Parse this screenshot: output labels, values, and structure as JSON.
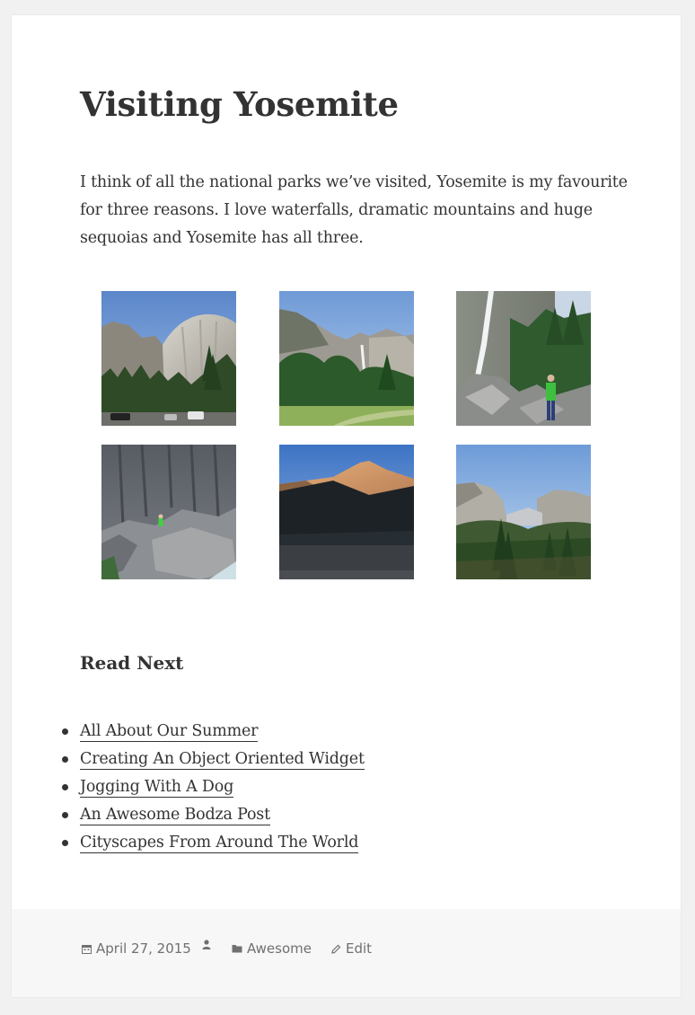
{
  "post": {
    "title": "Visiting Yosemite",
    "intro": "I think of all the national parks we’ve visited, Yosemite is my favourite for three reasons. I love waterfalls, dramatic mountains and huge sequoias and Yosemite has all three."
  },
  "gallery": {
    "images": [
      {
        "subject": "granite-cliff-photo"
      },
      {
        "subject": "valley-waterfall-photo"
      },
      {
        "subject": "waterfall-hiker-photo"
      },
      {
        "subject": "rock-wall-climber-photo"
      },
      {
        "subject": "sunset-peak-photo"
      },
      {
        "subject": "tunnel-view-photo"
      }
    ]
  },
  "read_next": {
    "title": "Read Next",
    "items": [
      {
        "label": "All About Our Summer"
      },
      {
        "label": "Creating An Object Oriented Widget"
      },
      {
        "label": "Jogging With A Dog"
      },
      {
        "label": "An Awesome Bodza Post"
      },
      {
        "label": "Cityscapes From Around The World"
      }
    ]
  },
  "footer": {
    "date": "April 27, 2015",
    "category": "Awesome",
    "edit_label": "Edit",
    "icons": {
      "date": "calendar-icon",
      "author": "person-icon",
      "category": "folder-icon",
      "edit": "pencil-icon"
    }
  },
  "colors": {
    "background": "#f1f1f1",
    "card": "#ffffff",
    "text": "#333333",
    "footer_bg": "#f7f7f7",
    "meta_text": "#707070"
  }
}
